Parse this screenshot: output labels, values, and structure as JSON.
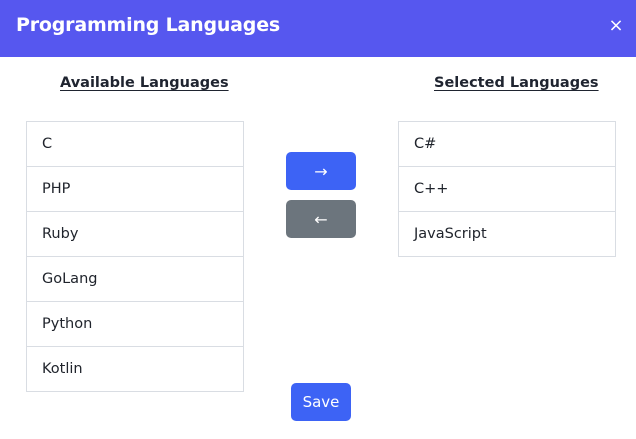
{
  "dialog": {
    "title": "Programming Languages",
    "close_icon": "×"
  },
  "available": {
    "heading": "Available Languages",
    "items": [
      "C",
      "PHP",
      "Ruby",
      "GoLang",
      "Python",
      "Kotlin"
    ]
  },
  "selected": {
    "heading": "Selected Languages",
    "items": [
      "C#",
      "C++",
      "JavaScript"
    ]
  },
  "actions": {
    "move_right_icon": "→",
    "move_left_icon": "←",
    "save_label": "Save"
  },
  "colors": {
    "header": "#5657ef",
    "primary_button": "#3d63f5",
    "secondary_button": "#6c757d",
    "border": "#d9dde3"
  }
}
